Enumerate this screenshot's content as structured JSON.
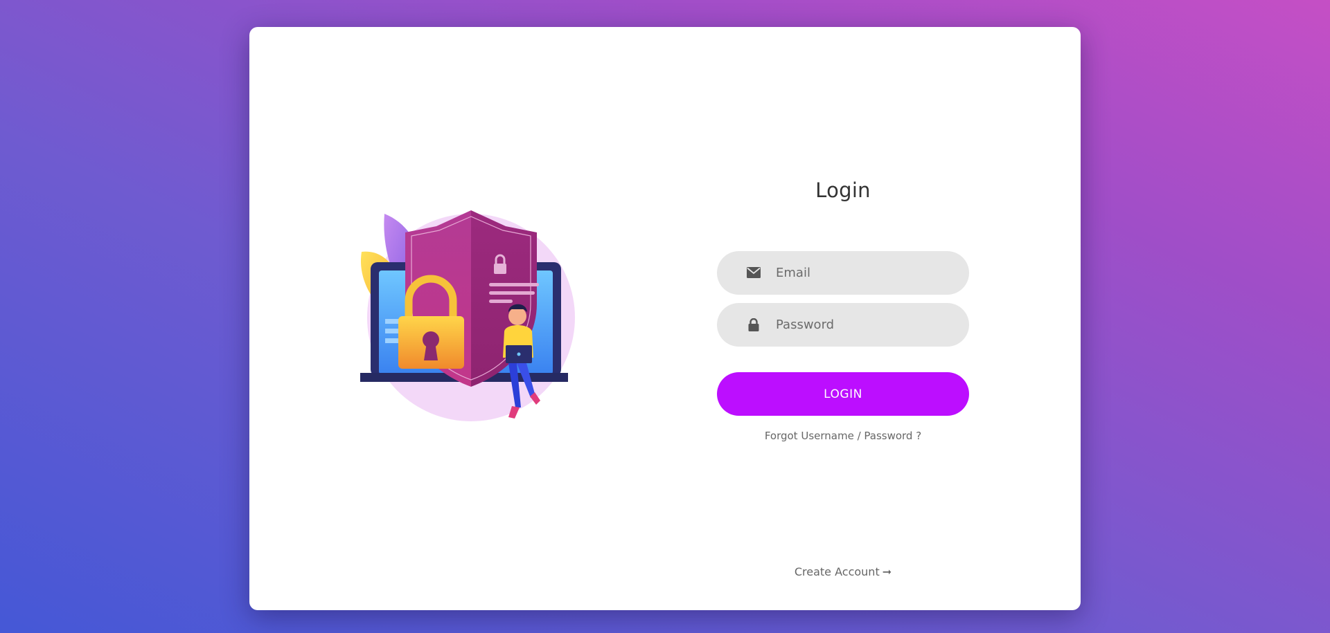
{
  "login": {
    "title": "Login",
    "email_placeholder": "Email",
    "password_placeholder": "Password",
    "submit_label": "LOGIN",
    "forgot_text": "Forgot Username / Password ?",
    "create_account_text": "Create Account",
    "create_account_arrow": "➞"
  },
  "icons": {
    "email": "envelope-icon",
    "password": "lock-icon",
    "illustration": "security-shield-illustration"
  },
  "colors": {
    "button": "#bc0eff",
    "field_background": "#e6e6e6",
    "card": "#ffffff"
  }
}
